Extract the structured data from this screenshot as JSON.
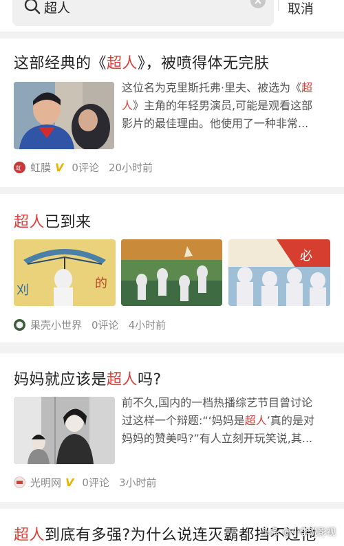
{
  "search": {
    "query": "超人",
    "cancel_label": "取消"
  },
  "articles": [
    {
      "title_pre": "这部经典的《",
      "title_hl": "超人",
      "title_post": "》，被喷得体无完肤",
      "summary_l1_pre": "这位名为克里斯托弗·里夫、被选为《",
      "summary_l1_hl": "超",
      "summary_l2_hl": "人",
      "summary_l2_post": "》主角的年轻男演员,可能是观看这部",
      "summary_l3": "影片的最佳理由。他使用了一种非常...",
      "source": "虹膜",
      "comments": "0评论",
      "time": "20小时前"
    },
    {
      "title_hl": "超人",
      "title_post": "已到来",
      "source": "果壳小世界",
      "comments": "0评论",
      "time": "4小时前"
    },
    {
      "title_pre": "妈妈就应该是",
      "title_hl": "超人",
      "title_post": "吗?",
      "summary_l1": "前不久,国内的一档热播综艺节目曾讨论",
      "summary_l2_pre": "过这样一个辩题:“‘妈妈是",
      "summary_l2_hl": "超人",
      "summary_l2_post": "’真的是对",
      "summary_l3": "妈妈的赞美吗?”有人立刻开玩笑说,其...",
      "source": "光明网",
      "comments": "0评论",
      "time": "3小时前"
    },
    {
      "title_hl": "超人",
      "title_post": "到底有多强?为什么说连灭霸都挡不过他"
    }
  ],
  "watermark": "头条 @小李说影视"
}
